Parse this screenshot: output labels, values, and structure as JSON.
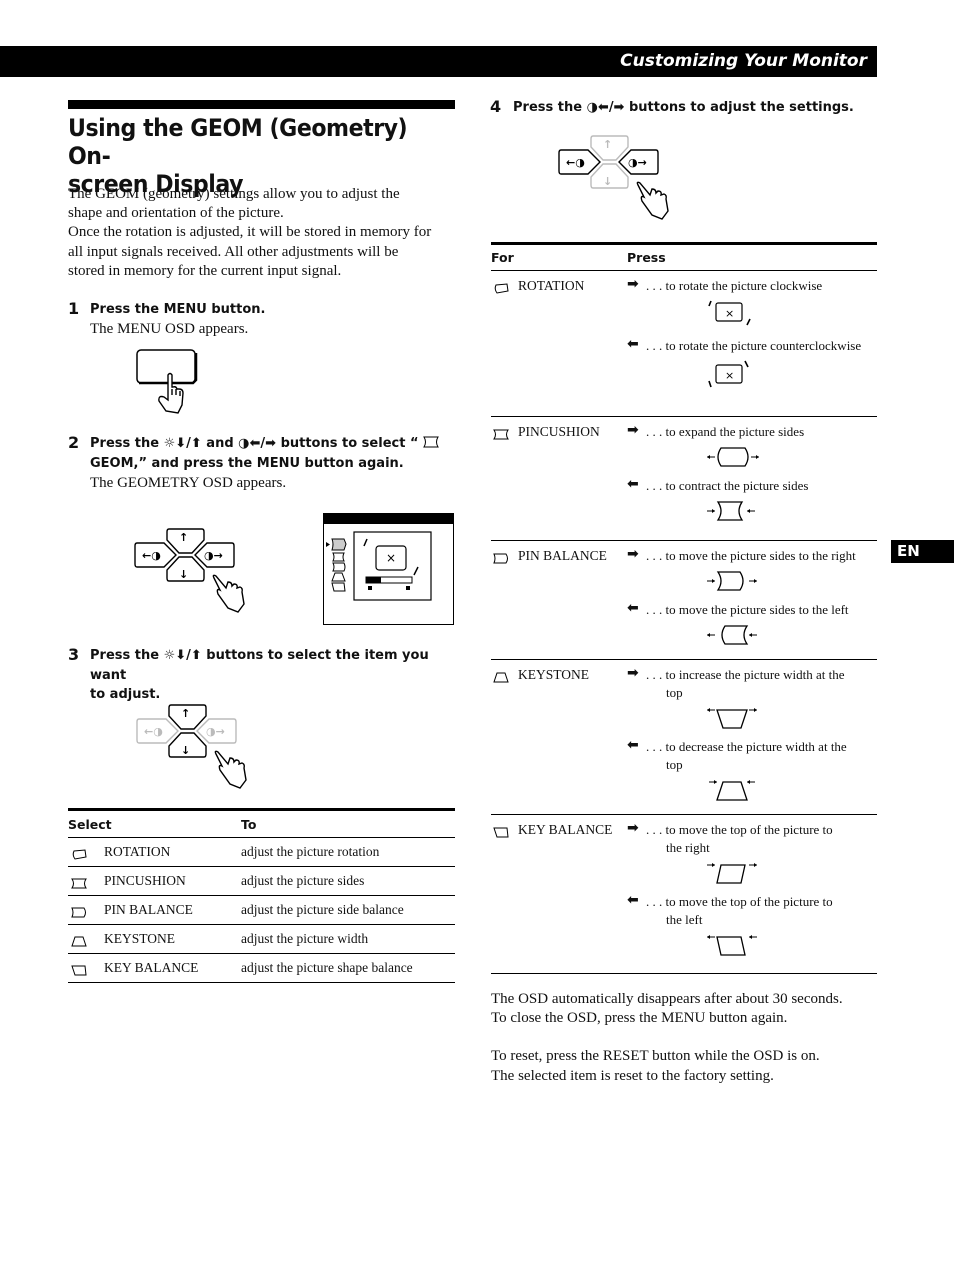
{
  "header": {
    "section_title": "Customizing Your Monitor"
  },
  "page": {
    "title": "Using the GEOM (Geometry) On-screen Display",
    "title_line1": "Using the GEOM (Geometry) On-",
    "title_line2": "screen Display",
    "intro_lines": [
      "The GEOM (geometry) settings allow you to adjust the",
      "shape and orientation of the picture.",
      "Once the rotation is adjusted, it will be stored in memory for",
      "all input signals received. All other adjustments will be",
      "stored in memory for the current input signal."
    ],
    "language_tab": "EN"
  },
  "steps": [
    {
      "number": "1",
      "title": "Press the MENU button.",
      "note": "The MENU OSD appears."
    },
    {
      "number": "2",
      "title_part1": "Press the ",
      "title_part2": " and ",
      "title_part3": " buttons to select “",
      "title_part4": "GEOM,” and press the MENU button again.",
      "note": "The GEOMETRY OSD appears."
    },
    {
      "number": "3",
      "title_part1": "Press the ",
      "title_part2": " buttons to select the item you want",
      "title_part3": "to adjust."
    },
    {
      "number": "4",
      "title_part1": "Press the ",
      "title_part2": " buttons to adjust the settings."
    }
  ],
  "glyphs": {
    "brightness_down_up": "☼⬇/⬆",
    "contrast_left_right": "◑⬅/➡",
    "right_arrow": "➡",
    "left_arrow": "⬅",
    "close_x": "×"
  },
  "select_table": {
    "headers": [
      "Select",
      "To"
    ],
    "rows": [
      {
        "icon": "rotation-icon",
        "item": "ROTATION",
        "action": "adjust the picture rotation"
      },
      {
        "icon": "pincushion-icon",
        "item": "PINCUSHION",
        "action": "adjust the picture sides"
      },
      {
        "icon": "pin-balance-icon",
        "item": "PIN BALANCE",
        "action": "adjust the picture side balance"
      },
      {
        "icon": "keystone-icon",
        "item": "KEYSTONE",
        "action": "adjust the picture width"
      },
      {
        "icon": "key-balance-icon",
        "item": "KEY BALANCE",
        "action": "adjust the picture shape balance"
      }
    ]
  },
  "press_table": {
    "headers": [
      "For",
      "Press"
    ],
    "rows": [
      {
        "item": "ROTATION",
        "right": ". . . to rotate the picture clockwise",
        "left": ". . . to rotate the picture counterclockwise"
      },
      {
        "item": "PINCUSHION",
        "right": ". . . to expand the picture sides",
        "left": ". . . to contract the picture sides"
      },
      {
        "item": "PIN BALANCE",
        "right": ". . . to move the picture sides to the right",
        "left": ". . . to move the picture sides to the left"
      },
      {
        "item": "KEYSTONE",
        "right": ". . . to increase the picture width at the",
        "right2": "top",
        "left": ". . . to decrease the picture width at the",
        "left2": "top"
      },
      {
        "item": "KEY BALANCE",
        "right": ". . . to move the top of  the picture to",
        "right2": "the right",
        "left": ". . .  to move the top of  the picture to",
        "left2": "the left"
      }
    ]
  },
  "footer_notes": [
    "The OSD automatically disappears after about 30 seconds.",
    "To close the OSD, press the MENU button again.",
    "To reset,  press the RESET button while the OSD is on.",
    "The selected item is reset to the factory setting."
  ]
}
